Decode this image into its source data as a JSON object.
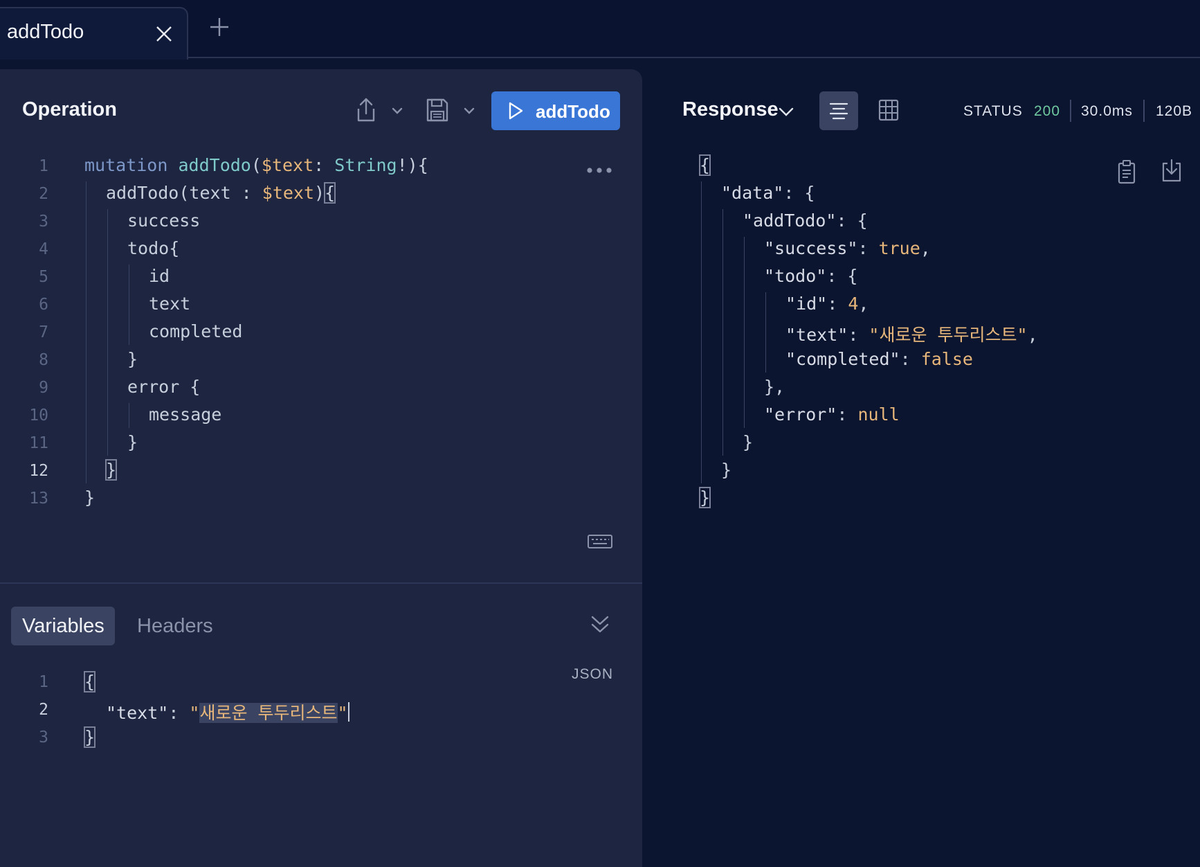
{
  "tab": {
    "title": "addTodo"
  },
  "operation": {
    "label": "Operation",
    "run_label": "addTodo",
    "line_numbers": [
      "1",
      "2",
      "3",
      "4",
      "5",
      "6",
      "7",
      "8",
      "9",
      "10",
      "11",
      "12",
      "13"
    ],
    "current_line": "12",
    "code": {
      "l1": {
        "kw": "mutation",
        "name": "addTodo",
        "open": "(",
        "var": "$text",
        "colon": ": ",
        "type": "String",
        "rest": "!){"
      },
      "l2": {
        "name": "addTodo",
        "open": "(text : ",
        "var": "$text",
        "close": ")",
        "brace": "{"
      },
      "l3": "success",
      "l4": "todo{",
      "l5": "id",
      "l6": "text",
      "l7": "completed",
      "l8": "}",
      "l9": "error {",
      "l10": "message",
      "l11": "}",
      "l12": "}",
      "l13": "}"
    }
  },
  "variables": {
    "tab_label": "Variables",
    "headers_label": "Headers",
    "badge": "JSON",
    "line_numbers": [
      "1",
      "2",
      "3"
    ],
    "current_line": "2",
    "code": {
      "l1": "{",
      "key": "\"text\"",
      "colon": ": ",
      "quote_open": "\"",
      "value": "새로운 투두리스트",
      "quote_close": "\"",
      "l3": "}"
    }
  },
  "response": {
    "label": "Response",
    "status_label": "STATUS",
    "status_code": "200",
    "time": "30.0ms",
    "size": "120B",
    "json": {
      "l1": "{",
      "l2_key": "\"data\"",
      "l2_rest": ": {",
      "l3_key": "\"addTodo\"",
      "l3_rest": ": {",
      "l4_key": "\"success\"",
      "l4_colon": ": ",
      "l4_val": "true",
      "l4_comma": ",",
      "l5_key": "\"todo\"",
      "l5_rest": ": {",
      "l6_key": "\"id\"",
      "l6_colon": ": ",
      "l6_val": "4",
      "l6_comma": ",",
      "l7_key": "\"text\"",
      "l7_colon": ": ",
      "l7_val": "\"새로운 투두리스트\"",
      "l7_comma": ",",
      "l8_key": "\"completed\"",
      "l8_colon": ": ",
      "l8_val": "false",
      "l9": "},",
      "l10_key": "\"error\"",
      "l10_colon": ": ",
      "l10_val": "null",
      "l11": "}",
      "l12": "}",
      "l13": "}"
    }
  },
  "colors": {
    "accent": "#3a76d5",
    "status_ok": "#6fc9a0",
    "string": "#e7b67a",
    "keyword": "#7d98c8",
    "function": "#7fc9c9"
  }
}
